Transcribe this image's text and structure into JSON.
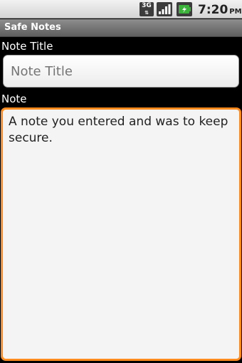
{
  "status_bar": {
    "network": "3G",
    "time": "7:20",
    "ampm": "PM",
    "icons": [
      "3g-icon",
      "signal-icon",
      "battery-icon"
    ],
    "battery_color": "#3cb43c"
  },
  "app": {
    "title": "Safe Notes",
    "accent_color": "#ff8a1e"
  },
  "form": {
    "title_label": "Note Title",
    "title_placeholder": "Note Title",
    "title_value": "",
    "note_label": "Note",
    "note_value": "A note you entered and was to keep secure."
  }
}
